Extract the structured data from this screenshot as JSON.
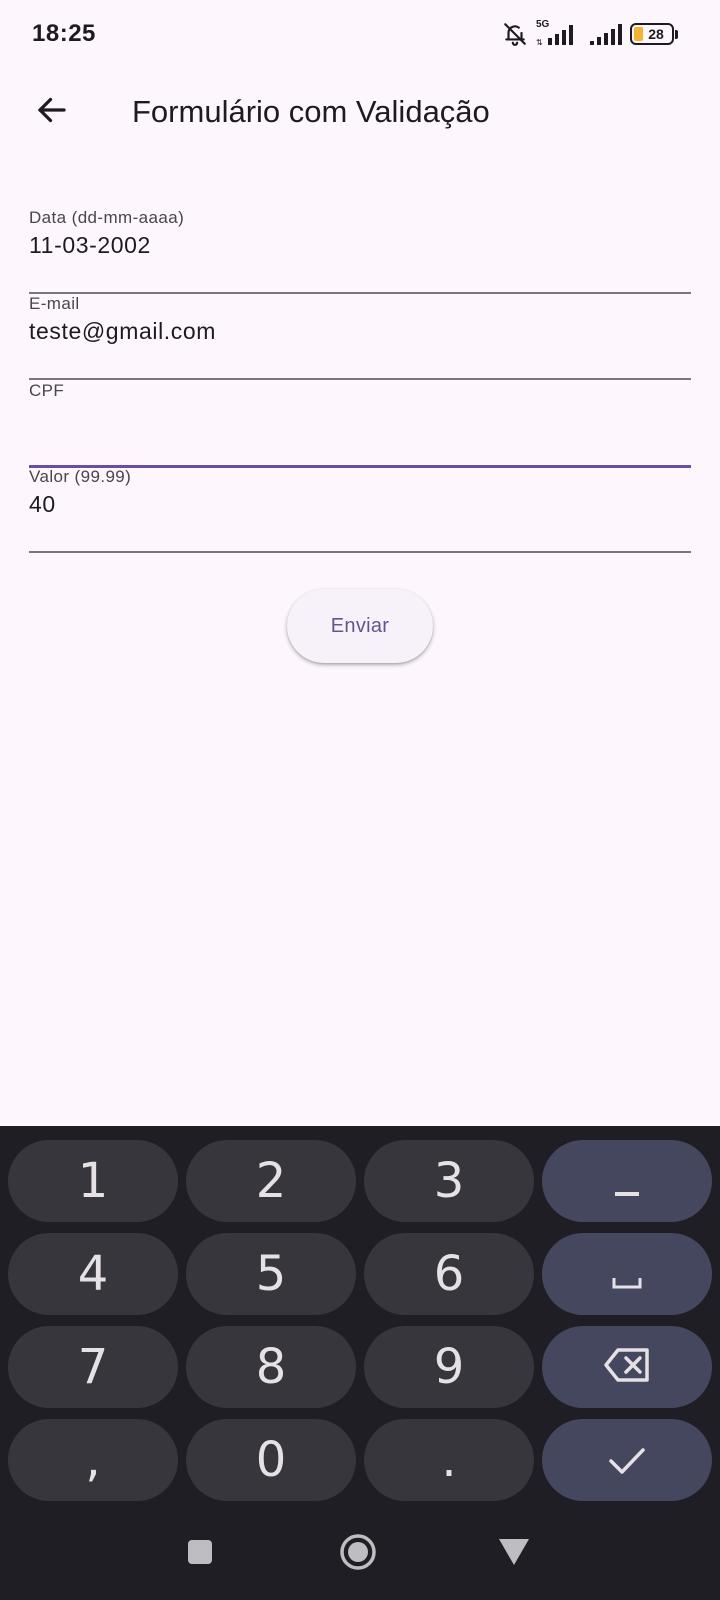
{
  "status_bar": {
    "time": "18:25",
    "network_label": "5G",
    "battery_level": "28",
    "icons": [
      "bell-off-icon",
      "signal-5g-icon",
      "signal-icon",
      "battery-icon"
    ]
  },
  "app_bar": {
    "title": "Formulário com Validação",
    "back_icon": "arrow-back-icon"
  },
  "form": {
    "fields": [
      {
        "label": "Data (dd-mm-aaaa)",
        "value": "11-03-2002",
        "focused": false
      },
      {
        "label": "E-mail",
        "value": "teste@gmail.com",
        "focused": false
      },
      {
        "label": "CPF",
        "value": "",
        "focused": true
      },
      {
        "label": "Valor (99.99)",
        "value": "40",
        "focused": false
      }
    ],
    "submit_label": "Enviar"
  },
  "keyboard": {
    "keys": [
      "1",
      "2",
      "3",
      "−",
      "4",
      "5",
      "6",
      "␣",
      "7",
      "8",
      "9",
      "⌫",
      ",",
      "0",
      ".",
      "✓"
    ],
    "colors": {
      "background": "#1e1e24",
      "key": "#36363c",
      "function_key": "#45475e"
    }
  },
  "nav_bar": {
    "buttons": [
      "recents-square-icon",
      "home-circle-icon",
      "back-triangle-icon"
    ]
  },
  "colors": {
    "background": "#fdf7fd",
    "accent": "#6750a4",
    "button_text": "#65558f",
    "battery": "#f2b531"
  }
}
